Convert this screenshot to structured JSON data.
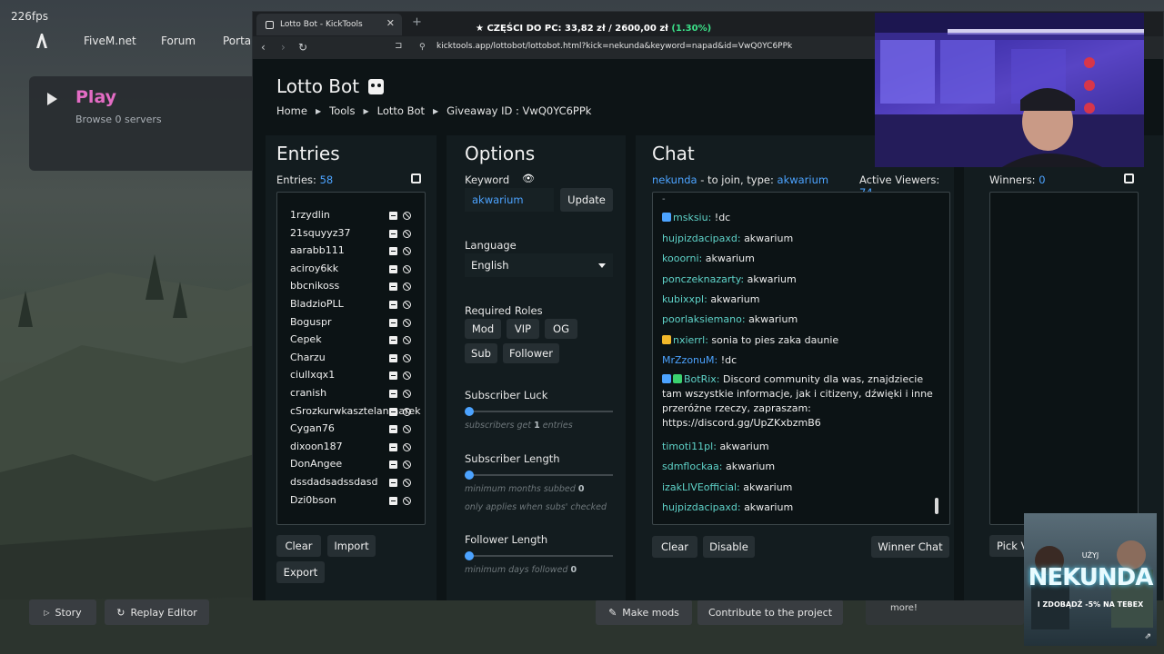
{
  "overlay": {
    "fps": "226fps"
  },
  "fivem": {
    "nav": [
      "FiveM.net",
      "Forum",
      "Portal"
    ],
    "play_title": "Play",
    "play_sub": "Browse 0 servers",
    "story_label": "Story",
    "replay_label": "Replay Editor",
    "make_mods_label": "Make mods",
    "contribute_label": "Contribute to the project",
    "more_text": "more!"
  },
  "browser": {
    "tab_title": "Lotto Bot - KickTools",
    "ticker_label": "★ CZĘŚCI DO PC:",
    "ticker_value": "33,82 zł / 2600,00 zł",
    "ticker_pct": "(1.30%)",
    "url": "kicktools.app/lottobot/lottobot.html?kick=nekunda&keyword=napad&id=VwQ0YC6PPk"
  },
  "page": {
    "title": "Lotto Bot",
    "breadcrumb": [
      "Home",
      "Tools",
      "Lotto Bot",
      "Giveaway ID :  VwQ0YC6PPk"
    ]
  },
  "entries": {
    "heading": "Entries",
    "count_label": "Entries:",
    "count": "58",
    "names": [
      "1rzydlin",
      "21squyyz37",
      "aarabb111",
      "aciroy6kk",
      "bbcnikoss",
      "BladzioPLL",
      "Boguspr",
      "Cepek",
      "Charzu",
      "ciullxqx1",
      "cranish",
      "cSrozkurwkasztelanmarek",
      "Cygan76",
      "dixoon187",
      "DonAngee",
      "dssdadsadssdasd",
      "Dzi0bson"
    ],
    "clear_label": "Clear",
    "import_label": "Import",
    "export_label": "Export"
  },
  "options": {
    "heading": "Options",
    "keyword_label": "Keyword",
    "keyword_value": "akwarium",
    "update_label": "Update",
    "language_label": "Language",
    "language_value": "English",
    "roles_label": "Required Roles",
    "roles": [
      "Mod",
      "VIP",
      "OG",
      "Sub",
      "Follower"
    ],
    "sub_luck_label": "Subscriber Luck",
    "sub_luck_hint": "subscribers get",
    "sub_luck_value": "1",
    "sub_luck_suffix": "entries",
    "sub_length_label": "Subscriber Length",
    "sub_length_hint": "minimum months subbed",
    "sub_length_value": "0",
    "sub_length_hint2": "only applies when subs' checked",
    "follower_length_label": "Follower Length",
    "follower_length_hint": "minimum days followed",
    "follower_length_value": "0"
  },
  "chat": {
    "heading": "Chat",
    "channel": "nekunda",
    "join_text": "- to join, type:",
    "keyword": "akwarium",
    "viewers_label": "Active Viewers:",
    "viewers": "74",
    "messages": [
      {
        "user": "msksiu:",
        "text": "!dc",
        "badge": "kick"
      },
      {
        "user": "hujpizdacipaxd:",
        "text": "akwarium"
      },
      {
        "user": "kooorni:",
        "text": "akwarium"
      },
      {
        "user": "ponczeknazarty:",
        "text": "akwarium"
      },
      {
        "user": "kubixxpl:",
        "text": "akwarium"
      },
      {
        "user": "poorlaksiemano:",
        "text": "akwarium"
      },
      {
        "user": "nxierrl:",
        "text": "sonia to pies zaka daunie",
        "badge": "crown"
      },
      {
        "user": "MrZzonuM:",
        "text": "!dc"
      },
      {
        "user": "BotRix:",
        "text": "Discord community dla was, znajdziecie tam wszystkie informacje, jak i citizeny, dźwięki i inne przeróżne rzeczy, zapraszam: https://discord.gg/UpZKxbzmB6",
        "badge": "bot"
      },
      {
        "user": "timoti11pl:",
        "text": "akwarium"
      },
      {
        "user": "sdmflockaa:",
        "text": "akwarium"
      },
      {
        "user": "izakLIVEofficial:",
        "text": "akwarium"
      },
      {
        "user": "hujpizdacipaxd:",
        "text": "akwarium"
      }
    ],
    "clear_label": "Clear",
    "disable_label": "Disable",
    "winner_chat_label": "Winner Chat"
  },
  "winners": {
    "label": "Winners:",
    "count": "0",
    "pick_label": "Pick V"
  },
  "ad": {
    "top": "UŻYJ",
    "brand": "NEKUNDA",
    "bottom": "I ZDOBĄDŹ -5% NA TEBEX"
  },
  "colors": {
    "accent": "#4ca3ff",
    "chat_user": "#5fd3c9",
    "play": "#e36cc4",
    "ticker_pct": "#3be088"
  }
}
